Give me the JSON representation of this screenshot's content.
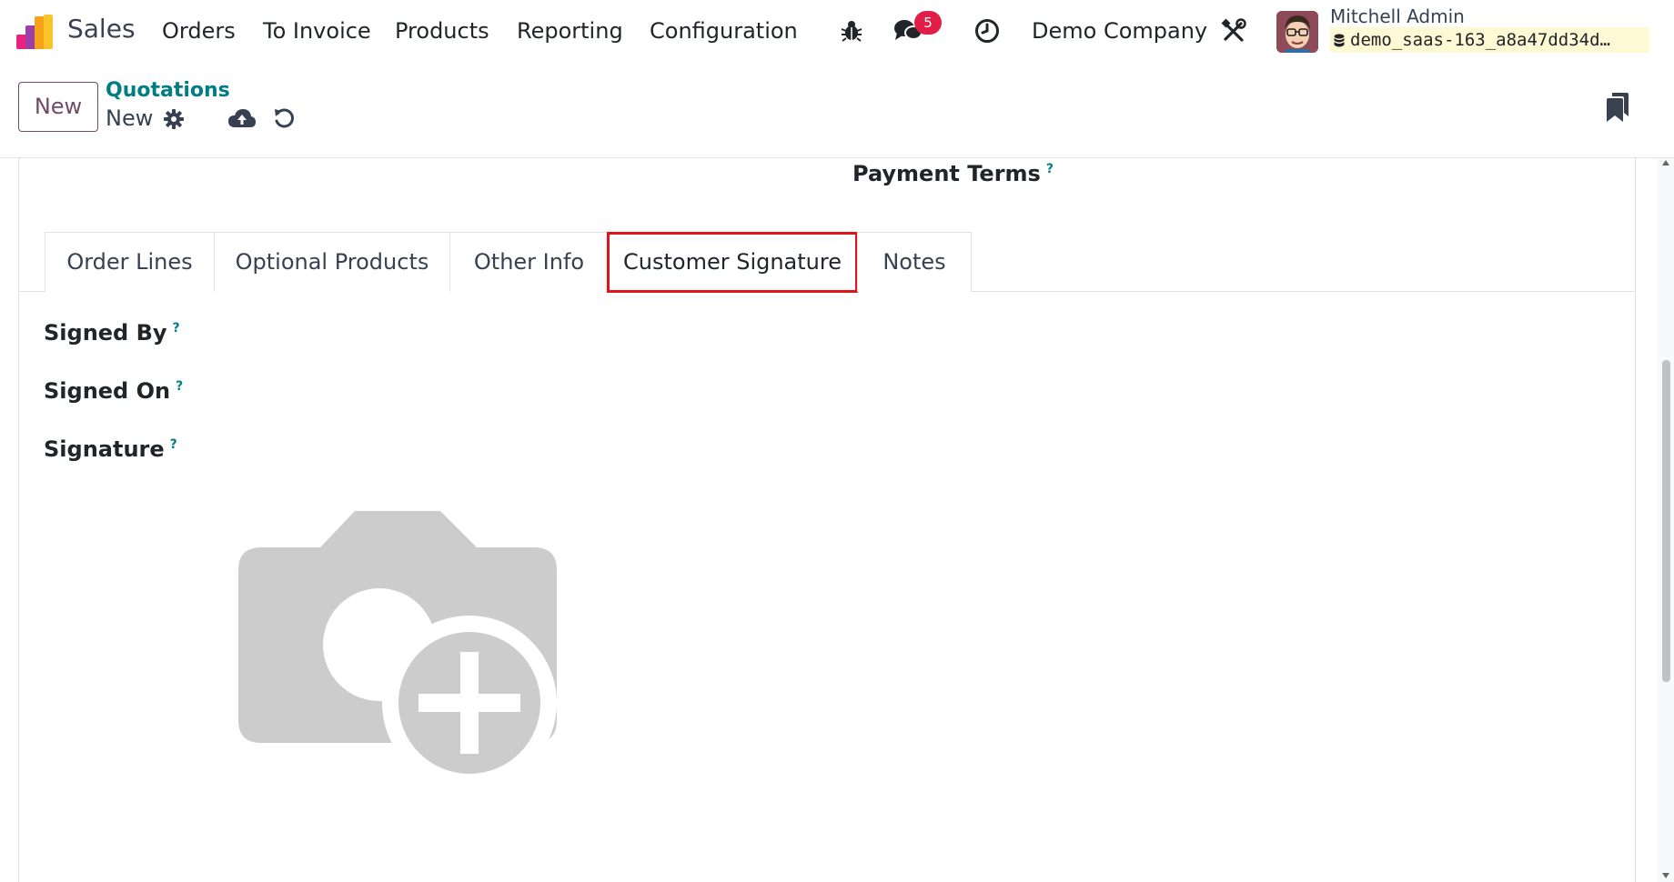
{
  "navbar": {
    "app_name": "Sales",
    "menu": [
      "Orders",
      "To Invoice",
      "Products",
      "Reporting",
      "Configuration"
    ],
    "messages_badge": "5",
    "company": "Demo Company",
    "user_name": "Mitchell Admin",
    "database": "demo_saas-163_a8a47dd34d…",
    "icons": [
      "debug-bug-icon",
      "chat-icon",
      "activity-clock-icon",
      "settings-tools-icon"
    ]
  },
  "control_panel": {
    "new_button": "New",
    "breadcrumb_parent": "Quotations",
    "breadcrumb_current": "New"
  },
  "form": {
    "payment_terms_label": "Payment Terms",
    "help_mark": "?",
    "tabs": [
      "Order Lines",
      "Optional Products",
      "Other Info",
      "Customer Signature",
      "Notes"
    ],
    "active_tab": "Customer Signature",
    "signed_by_label": "Signed By",
    "signed_on_label": "Signed On",
    "signature_label": "Signature"
  },
  "colors": {
    "brand": "#714b67",
    "link": "#017e84",
    "highlight": "#e0131a",
    "badge": "#e11d48",
    "placeholder_image": "#cccccc"
  }
}
